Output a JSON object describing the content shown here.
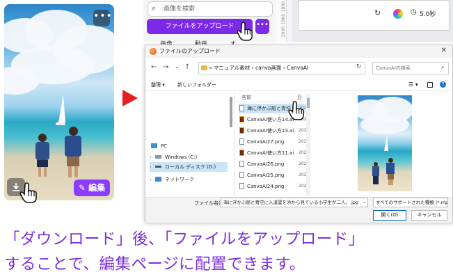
{
  "image_card": {
    "more_label": "•••",
    "download_icon": "download-icon",
    "edit_label": "✎ 編集"
  },
  "canva": {
    "search_placeholder": "画像を検索",
    "upload_button": "ファイルをアップロード",
    "upload_more": "•••",
    "tabs": [
      "画像",
      "動画",
      "オ",
      "ォ"
    ],
    "ruler_numbers": [
      "1800",
      "1900",
      "2000"
    ],
    "duration": "5.0秒"
  },
  "dialog": {
    "title": "ファイルのアップロード",
    "close": "✕",
    "address": "« マニュアル素材 › canva画面 › CanvaAI",
    "search_placeholder": "CanvaAIの検索",
    "organize": "整理 ▾",
    "new_folder": "新しいフォルダー",
    "nav_items": [
      {
        "label": "PC",
        "selected": false
      },
      {
        "label": "Windows (C:)",
        "selected": false
      },
      {
        "label": "ローカル ディスク (D:)",
        "selected": true
      },
      {
        "label": "ネットワーク",
        "selected": false
      }
    ],
    "column_name": "名前",
    "column_date": "日",
    "files": [
      {
        "name": "海に浮かぶ船と青空",
        "type": "img",
        "date": "202",
        "selected": true
      },
      {
        "name": "CanvaAI使い方14.ai",
        "type": "ai",
        "date": "202",
        "selected": false
      },
      {
        "name": "CanvaAI使い方13.ai",
        "type": "ai",
        "date": "202",
        "selected": false
      },
      {
        "name": "CanvaAI27.png",
        "type": "img",
        "date": "202",
        "selected": false
      },
      {
        "name": "CanvaAI使い方11.ai",
        "type": "ai",
        "date": "202",
        "selected": false
      },
      {
        "name": "CanvaAI26.png",
        "type": "img",
        "date": "202",
        "selected": false
      },
      {
        "name": "CanvaAI25.png",
        "type": "img",
        "date": "202",
        "selected": false
      },
      {
        "name": "CanvaAI24.png",
        "type": "img",
        "date": "202",
        "selected": false
      }
    ],
    "filename_label": "ファイル名(N):",
    "filename_value": "海に浮かぶ船と青空に入道雲を浜から見ている小学生が二人。.jpg",
    "filetype_value": "すべてのサポートされた種類 (*.mp3",
    "open_button": "開く(O)",
    "cancel_button": "キャンセル"
  },
  "caption": {
    "line1": "「ダウンロード」後、「ファイルをアップロード」",
    "line2": "することで、編集ページに配置できます。"
  },
  "colors": {
    "accent_purple": "#7d2ae8",
    "caption_purple": "#7b2fe0",
    "arrow_red": "#e52020"
  }
}
